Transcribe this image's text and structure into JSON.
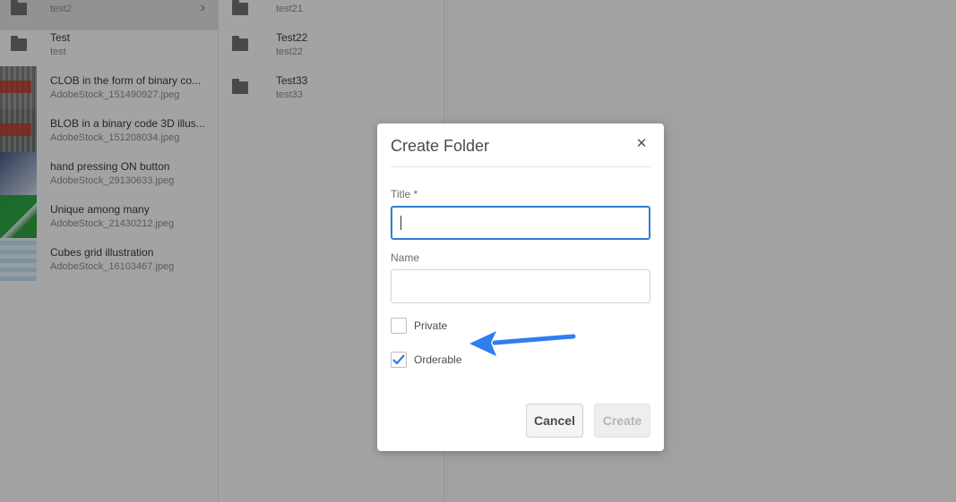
{
  "columns": {
    "col1": {
      "items": [
        {
          "title": "",
          "subtitle": "test2",
          "thumb": "folder-icon"
        },
        {
          "title": "Test",
          "subtitle": "test",
          "thumb": "folder-icon"
        },
        {
          "title": "CLOB in the form of binary co...",
          "subtitle": "AdobeStock_151490927.jpeg",
          "thumb": "image"
        },
        {
          "title": "BLOB in a binary code 3D illus...",
          "subtitle": "AdobeStock_151208034.jpeg",
          "thumb": "image"
        },
        {
          "title": "hand pressing ON button",
          "subtitle": "AdobeStock_29130633.jpeg",
          "thumb": "image"
        },
        {
          "title": "Unique among many",
          "subtitle": "AdobeStock_21430212.jpeg",
          "thumb": "image"
        },
        {
          "title": "Cubes grid illustration",
          "subtitle": "AdobeStock_16103467.jpeg",
          "thumb": "image"
        }
      ]
    },
    "col2": {
      "items": [
        {
          "title": "",
          "subtitle": "test21",
          "thumb": "folder-icon"
        },
        {
          "title": "Test22",
          "subtitle": "test22",
          "thumb": "folder-icon"
        },
        {
          "title": "Test33",
          "subtitle": "test33",
          "thumb": "folder-icon"
        }
      ]
    }
  },
  "dialog": {
    "title": "Create Folder",
    "close_icon": "close-icon",
    "title_label": "Title *",
    "title_value": "",
    "name_label": "Name",
    "name_value": "",
    "private_label": "Private",
    "private_checked": false,
    "orderable_label": "Orderable",
    "orderable_checked": true,
    "cancel_label": "Cancel",
    "create_label": "Create"
  },
  "colors": {
    "accent": "#2d7dd2",
    "arrow": "#2f7ef0",
    "overlay": "rgba(0,0,0,0.34)"
  }
}
